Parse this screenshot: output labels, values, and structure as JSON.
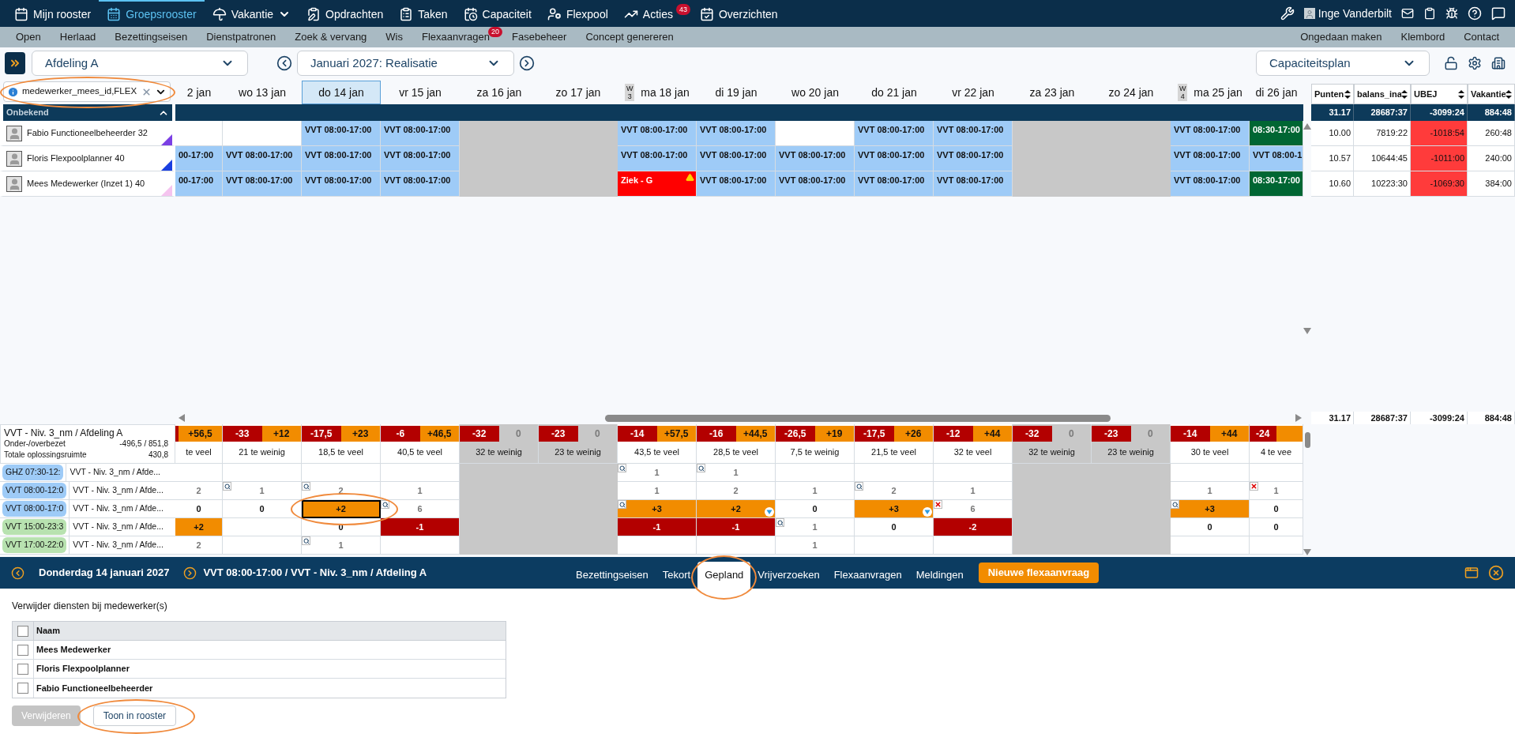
{
  "nav": {
    "items": [
      {
        "label": "Mijn rooster",
        "selected": false
      },
      {
        "label": "Groepsrooster",
        "selected": true
      },
      {
        "label": "Vakantie",
        "selected": false,
        "dropdown": true
      },
      {
        "label": "Opdrachten",
        "selected": false
      },
      {
        "label": "Taken",
        "selected": false
      },
      {
        "label": "Capaciteit",
        "selected": false
      },
      {
        "label": "Flexpool",
        "selected": false
      },
      {
        "label": "Acties",
        "selected": false,
        "badge": "43"
      },
      {
        "label": "Overzichten",
        "selected": false
      }
    ],
    "user": "Inge Vanderbilt"
  },
  "subnav": {
    "items": [
      {
        "label": "Open"
      },
      {
        "label": "Herlaad"
      },
      {
        "label": "Bezettingseisen"
      },
      {
        "label": "Dienstpatronen"
      },
      {
        "label": "Zoek & vervang"
      },
      {
        "label": "Wis"
      },
      {
        "label": "Flexaanvragen",
        "badge": "20"
      },
      {
        "label": "Fasebeheer"
      },
      {
        "label": "Concept genereren"
      }
    ],
    "right_items": [
      "Ongedaan maken",
      "Klembord",
      "Contact"
    ]
  },
  "toolbar": {
    "department": "Afdeling A",
    "period": "Januari 2027: Realisatie",
    "view": "Capaciteitsplan"
  },
  "filter": {
    "value": "medewerker_mees_id,FLEX",
    "highlighted": true
  },
  "group": {
    "label": "Onbekend",
    "expanded": true
  },
  "days": [
    {
      "label": "2 jan",
      "weekend": false,
      "selected": false
    },
    {
      "label": "wo 13 jan",
      "weekend": false,
      "selected": false
    },
    {
      "label": "do 14 jan",
      "weekend": false,
      "selected": true
    },
    {
      "label": "vr 15 jan",
      "weekend": false,
      "selected": false
    },
    {
      "label": "za 16 jan",
      "weekend": true,
      "selected": false
    },
    {
      "label": "zo 17 jan",
      "weekend": true,
      "selected": false
    },
    {
      "label": "ma 18 jan",
      "weekend": false,
      "selected": false,
      "week_letter": "W",
      "week_number": "3"
    },
    {
      "label": "di 19 jan",
      "weekend": false,
      "selected": false
    },
    {
      "label": "wo 20 jan",
      "weekend": false,
      "selected": false
    },
    {
      "label": "do 21 jan",
      "weekend": false,
      "selected": false
    },
    {
      "label": "vr 22 jan",
      "weekend": false,
      "selected": false
    },
    {
      "label": "za 23 jan",
      "weekend": true,
      "selected": false
    },
    {
      "label": "zo 24 jan",
      "weekend": true,
      "selected": false
    },
    {
      "label": "ma 25 jan",
      "weekend": false,
      "selected": false,
      "week_letter": "W",
      "week_number": "4"
    },
    {
      "label": "di 26 jan",
      "weekend": false,
      "selected": false
    }
  ],
  "employees": [
    {
      "name": "Fabio Functioneelbeheerder 32",
      "color": "#7b3fe4",
      "cells": [
        {
          "kind": "empty"
        },
        {
          "kind": "empty"
        },
        {
          "kind": "shift",
          "text": "VVT 08:00-17:00"
        },
        {
          "kind": "shift",
          "text": "VVT 08:00-17:00"
        },
        {
          "kind": "weekend"
        },
        {
          "kind": "weekend"
        },
        {
          "kind": "shift",
          "text": "VVT 08:00-17:00"
        },
        {
          "kind": "shift",
          "text": "VVT 08:00-17:00"
        },
        {
          "kind": "empty"
        },
        {
          "kind": "shift",
          "text": "VVT 08:00-17:00"
        },
        {
          "kind": "shift",
          "text": "VVT 08:00-17:00"
        },
        {
          "kind": "weekend"
        },
        {
          "kind": "weekend"
        },
        {
          "kind": "shift",
          "text": "VVT 08:00-17:00"
        },
        {
          "kind": "green",
          "text": "08:30-17:00"
        }
      ]
    },
    {
      "name": "Floris Flexpoolplanner 40",
      "color": "#1a3fe0",
      "cells": [
        {
          "kind": "shift",
          "text": "00-17:00"
        },
        {
          "kind": "shift",
          "text": "VVT 08:00-17:00"
        },
        {
          "kind": "shift",
          "text": "VVT 08:00-17:00"
        },
        {
          "kind": "shift",
          "text": "VVT 08:00-17:00"
        },
        {
          "kind": "weekend"
        },
        {
          "kind": "weekend"
        },
        {
          "kind": "shift",
          "text": "VVT 08:00-17:00"
        },
        {
          "kind": "shift",
          "text": "VVT 08:00-17:00"
        },
        {
          "kind": "shift",
          "text": "VVT 08:00-17:00"
        },
        {
          "kind": "shift",
          "text": "VVT 08:00-17:00"
        },
        {
          "kind": "shift",
          "text": "VVT 08:00-17:00"
        },
        {
          "kind": "weekend"
        },
        {
          "kind": "weekend"
        },
        {
          "kind": "shift",
          "text": "VVT 08:00-17:00"
        },
        {
          "kind": "shift",
          "text": "VVT 08:00-1"
        }
      ]
    },
    {
      "name": "Mees Medewerker (Inzet 1) 40",
      "color": "#f5c4ef",
      "cells": [
        {
          "kind": "shift",
          "text": "00-17:00"
        },
        {
          "kind": "shift",
          "text": "VVT 08:00-17:00"
        },
        {
          "kind": "shift",
          "text": "VVT 08:00-17:00"
        },
        {
          "kind": "shift",
          "text": "VVT 08:00-17:00"
        },
        {
          "kind": "weekend"
        },
        {
          "kind": "weekend"
        },
        {
          "kind": "sick",
          "text": "Ziek - G"
        },
        {
          "kind": "shift",
          "text": "VVT 08:00-17:00"
        },
        {
          "kind": "shift",
          "text": "VVT 08:00-17:00"
        },
        {
          "kind": "shift",
          "text": "VVT 08:00-17:00"
        },
        {
          "kind": "shift",
          "text": "VVT 08:00-17:00"
        },
        {
          "kind": "weekend"
        },
        {
          "kind": "weekend"
        },
        {
          "kind": "shift",
          "text": "VVT 08:00-17:00"
        },
        {
          "kind": "green",
          "text": "08:30-17:00"
        }
      ]
    }
  ],
  "side_table": {
    "columns": [
      "Punten",
      "balans_ina",
      "UBEJ",
      "Vakantie"
    ],
    "totals": [
      "31.17",
      "28687:37",
      "-3099:24",
      "884:48"
    ],
    "rows": [
      [
        "10.00",
        "7819:22",
        "-1018:54",
        "260:48"
      ],
      [
        "10.57",
        "10644:45",
        "-1011:00",
        "240:00"
      ],
      [
        "10.60",
        "10223:30",
        "-1069:30",
        "384:00"
      ]
    ],
    "footer": [
      "31.17",
      "28687:37",
      "-3099:24",
      "884:48"
    ]
  },
  "coverage": {
    "title": "VVT - Niv. 3_nm / Afdeling A",
    "stats": [
      {
        "label": "Onder-/overbezet",
        "value": "-496,5 / 851,8"
      },
      {
        "label": "Totale oplossingsruimte",
        "value": "430,8"
      }
    ],
    "balance": [
      {
        "plus": "+56,5"
      },
      {
        "minus": "-33",
        "plus": "+12"
      },
      {
        "minus": "-17,5",
        "plus": "+23"
      },
      {
        "minus": "-6",
        "plus": "+46,5"
      },
      {
        "minus": "-32",
        "plus": "0"
      },
      {
        "minus": "-23",
        "plus": "0"
      },
      {
        "minus": "-14",
        "plus": "+57,5"
      },
      {
        "minus": "-16",
        "plus": "+44,5"
      },
      {
        "minus": "-26,5",
        "plus": "+19"
      },
      {
        "minus": "-17,5",
        "plus": "+26"
      },
      {
        "minus": "-12",
        "plus": "+44"
      },
      {
        "minus": "-32",
        "plus": "0"
      },
      {
        "minus": "-23",
        "plus": "0"
      },
      {
        "minus": "-14",
        "plus": "+44"
      },
      {
        "minus": "-24"
      }
    ],
    "summary": [
      "te veel",
      "21 te weinig",
      "18,5 te veel",
      "40,5 te veel",
      "32 te weinig",
      "23 te weinig",
      "43,5 te veel",
      "28,5 te veel",
      "7,5 te weinig",
      "21,5 te veel",
      "32 te veel",
      "32 te weinig",
      "23 te weinig",
      "30 te veel",
      "4 te vee"
    ],
    "shifts": [
      {
        "tag": "GHZ 07:30-12:",
        "kind": "day",
        "label": "VVT - Niv. 3_nm / Afde...",
        "cells": [
          {
            "kind": "empty",
            "selected": false
          },
          {
            "kind": "empty",
            "selected": false
          },
          {
            "kind": "empty",
            "selected": false
          },
          {
            "kind": "empty",
            "selected": false
          },
          {
            "kind": "weekend"
          },
          {
            "kind": "weekend"
          },
          {
            "kind": "plain",
            "text": "1",
            "search_icon": true,
            "selected": false
          },
          {
            "kind": "plain",
            "text": "1",
            "search_icon": true,
            "selected": false
          },
          {
            "kind": "empty",
            "selected": false
          },
          {
            "kind": "empty",
            "selected": false
          },
          {
            "kind": "empty",
            "selected": false
          },
          {
            "kind": "weekend"
          },
          {
            "kind": "weekend"
          },
          {
            "kind": "empty",
            "selected": false
          },
          {
            "kind": "empty",
            "selected": false
          }
        ]
      },
      {
        "tag": "VVT 08:00-12:0",
        "kind": "day",
        "label": "VVT - Niv. 3_nm / Afde...",
        "cells": [
          {
            "kind": "plain",
            "text": "2",
            "selected": false
          },
          {
            "kind": "plain",
            "text": "1",
            "search_icon": true,
            "selected": false
          },
          {
            "kind": "plain",
            "text": "2",
            "search_icon": true,
            "selected": false
          },
          {
            "kind": "plain",
            "text": "1",
            "selected": false
          },
          {
            "kind": "weekend"
          },
          {
            "kind": "weekend"
          },
          {
            "kind": "plain",
            "text": "1",
            "selected": false
          },
          {
            "kind": "plain",
            "text": "2",
            "selected": false
          },
          {
            "kind": "plain",
            "text": "1",
            "selected": false
          },
          {
            "kind": "plain",
            "text": "2",
            "search_icon": true,
            "selected": false
          },
          {
            "kind": "plain",
            "text": "1",
            "selected": false
          },
          {
            "kind": "weekend"
          },
          {
            "kind": "weekend"
          },
          {
            "kind": "plain",
            "text": "1",
            "selected": false
          },
          {
            "kind": "plain",
            "text": "1",
            "remove_icon": true,
            "selected": false
          }
        ]
      },
      {
        "tag": "VVT 08:00-17:0",
        "kind": "day",
        "label": "VVT - Niv. 3_nm / Afde...",
        "cells": [
          {
            "kind": "zero",
            "text": "0",
            "selected": false
          },
          {
            "kind": "zero",
            "text": "0",
            "selected": false
          },
          {
            "kind": "over",
            "text": "+2",
            "selected": true,
            "highlighted": true
          },
          {
            "kind": "plain",
            "text": "6",
            "search_icon": true,
            "selected": false
          },
          {
            "kind": "weekend"
          },
          {
            "kind": "weekend"
          },
          {
            "kind": "over",
            "text": "+3",
            "search_icon": true,
            "selected": false
          },
          {
            "kind": "over",
            "text": "+2",
            "filter_icon": true,
            "selected": false
          },
          {
            "kind": "zero",
            "text": "0",
            "selected": false
          },
          {
            "kind": "over",
            "text": "+3",
            "filter_icon": true,
            "selected": false
          },
          {
            "kind": "plain",
            "text": "6",
            "remove_icon": true,
            "selected": false
          },
          {
            "kind": "weekend"
          },
          {
            "kind": "weekend"
          },
          {
            "kind": "over",
            "text": "+3",
            "search_icon": true,
            "selected": false
          },
          {
            "kind": "zero",
            "text": "0",
            "selected": false
          }
        ]
      },
      {
        "tag": "VVT 15:00-23:3",
        "kind": "evening",
        "label": "VVT - Niv. 3_nm / Afde...",
        "cells": [
          {
            "kind": "over",
            "text": "+2",
            "selected": false
          },
          {
            "kind": "empty",
            "selected": false
          },
          {
            "kind": "zero",
            "text": "0",
            "selected": false
          },
          {
            "kind": "under",
            "text": "-1",
            "selected": false
          },
          {
            "kind": "weekend"
          },
          {
            "kind": "weekend"
          },
          {
            "kind": "under",
            "text": "-1",
            "selected": false
          },
          {
            "kind": "under",
            "text": "-1",
            "selected": false
          },
          {
            "kind": "plain",
            "text": "1",
            "search_icon": true,
            "selected": false
          },
          {
            "kind": "zero",
            "text": "0",
            "selected": false
          },
          {
            "kind": "under",
            "text": "-2",
            "selected": false
          },
          {
            "kind": "weekend"
          },
          {
            "kind": "weekend"
          },
          {
            "kind": "zero",
            "text": "0",
            "selected": false
          },
          {
            "kind": "zero",
            "text": "0",
            "selected": false
          }
        ]
      },
      {
        "tag": "VVT 17:00-22:0",
        "kind": "evening",
        "label": "VVT - Niv. 3_nm / Afde...",
        "cells": [
          {
            "kind": "plain",
            "text": "2",
            "selected": false
          },
          {
            "kind": "empty",
            "selected": false
          },
          {
            "kind": "plain",
            "text": "1",
            "search_icon": true,
            "selected": false
          },
          {
            "kind": "empty",
            "selected": false
          },
          {
            "kind": "weekend"
          },
          {
            "kind": "weekend"
          },
          {
            "kind": "empty",
            "selected": false
          },
          {
            "kind": "empty",
            "selected": false
          },
          {
            "kind": "plain",
            "text": "1",
            "selected": false
          },
          {
            "kind": "empty",
            "selected": false
          },
          {
            "kind": "empty",
            "selected": false
          },
          {
            "kind": "weekend"
          },
          {
            "kind": "weekend"
          },
          {
            "kind": "empty",
            "selected": false
          },
          {
            "kind": "empty",
            "selected": false
          }
        ]
      }
    ]
  },
  "detail": {
    "date": "Donderdag 14 januari 2027",
    "shift": "VVT 08:00-17:00 / VVT - Niv. 3_nm / Afdeling A",
    "tabs": [
      {
        "label": "Bezettingseisen",
        "selected": false
      },
      {
        "label": "Tekort",
        "selected": false
      },
      {
        "label": "Gepland",
        "selected": true,
        "highlighted": true
      },
      {
        "label": "Vrijverzoeken",
        "selected": false
      },
      {
        "label": "Flexaanvragen",
        "selected": false
      },
      {
        "label": "Meldingen",
        "selected": false
      }
    ],
    "action": "Nieuwe flexaanvraag",
    "heading": "Verwijder diensten bij medewerker(s)",
    "table": {
      "column": "Naam",
      "all_checked": false,
      "rows": [
        {
          "name": "Mees Medewerker",
          "checked": false
        },
        {
          "name": "Floris Flexpoolplanner",
          "checked": false
        },
        {
          "name": "Fabio Functioneelbeheerder",
          "checked": false
        }
      ]
    },
    "buttons": [
      {
        "label": "Verwijderen",
        "disabled": true
      },
      {
        "label": "Toon in rooster",
        "disabled": false,
        "highlighted": true
      }
    ]
  }
}
